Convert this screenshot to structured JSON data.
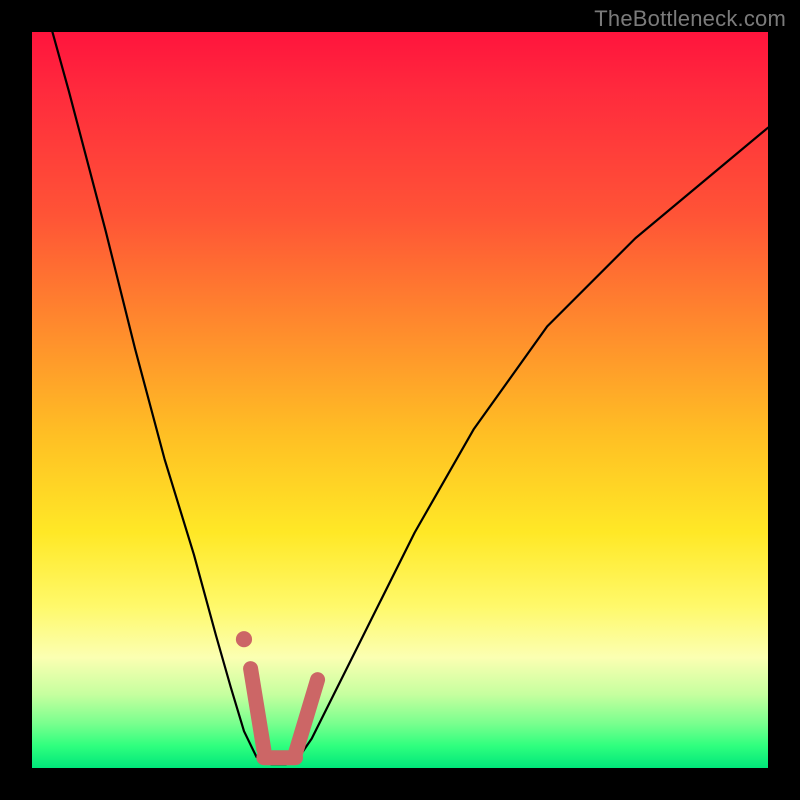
{
  "watermark": "TheBottleneck.com",
  "colors": {
    "frame": "#000000",
    "curve": "#000000",
    "marker": "#cc6666",
    "watermark": "#7b7b7b"
  },
  "chart_data": {
    "type": "line",
    "title": "",
    "xlabel": "",
    "ylabel": "",
    "xlim": [
      0,
      100
    ],
    "ylim": [
      0,
      100
    ],
    "grid": false,
    "series": [
      {
        "name": "bottleneck-curve",
        "x": [
          0,
          5,
          10,
          14,
          18,
          22,
          25,
          27,
          28.8,
          30.5,
          32.5,
          34.5,
          36.5,
          38,
          41,
          46,
          52,
          60,
          70,
          82,
          94,
          100
        ],
        "values": [
          110,
          92,
          73,
          57,
          42,
          29,
          18,
          11,
          5,
          1.5,
          0.5,
          0.5,
          1.8,
          4,
          10,
          20,
          32,
          46,
          60,
          72,
          82,
          87
        ]
      }
    ],
    "markers": [
      {
        "name": "dot-left",
        "x": 28.8,
        "y": 17.5,
        "r": 1.1
      },
      {
        "name": "thick-left-seg",
        "x0": 29.7,
        "y0": 13.5,
        "x1": 31.5,
        "y1": 2.5
      },
      {
        "name": "thick-bottom-seg",
        "x0": 31.5,
        "y0": 1.4,
        "x1": 35.8,
        "y1": 1.4
      },
      {
        "name": "thick-right-seg",
        "x0": 35.8,
        "y0": 2.0,
        "x1": 38.8,
        "y1": 12.0
      }
    ]
  }
}
